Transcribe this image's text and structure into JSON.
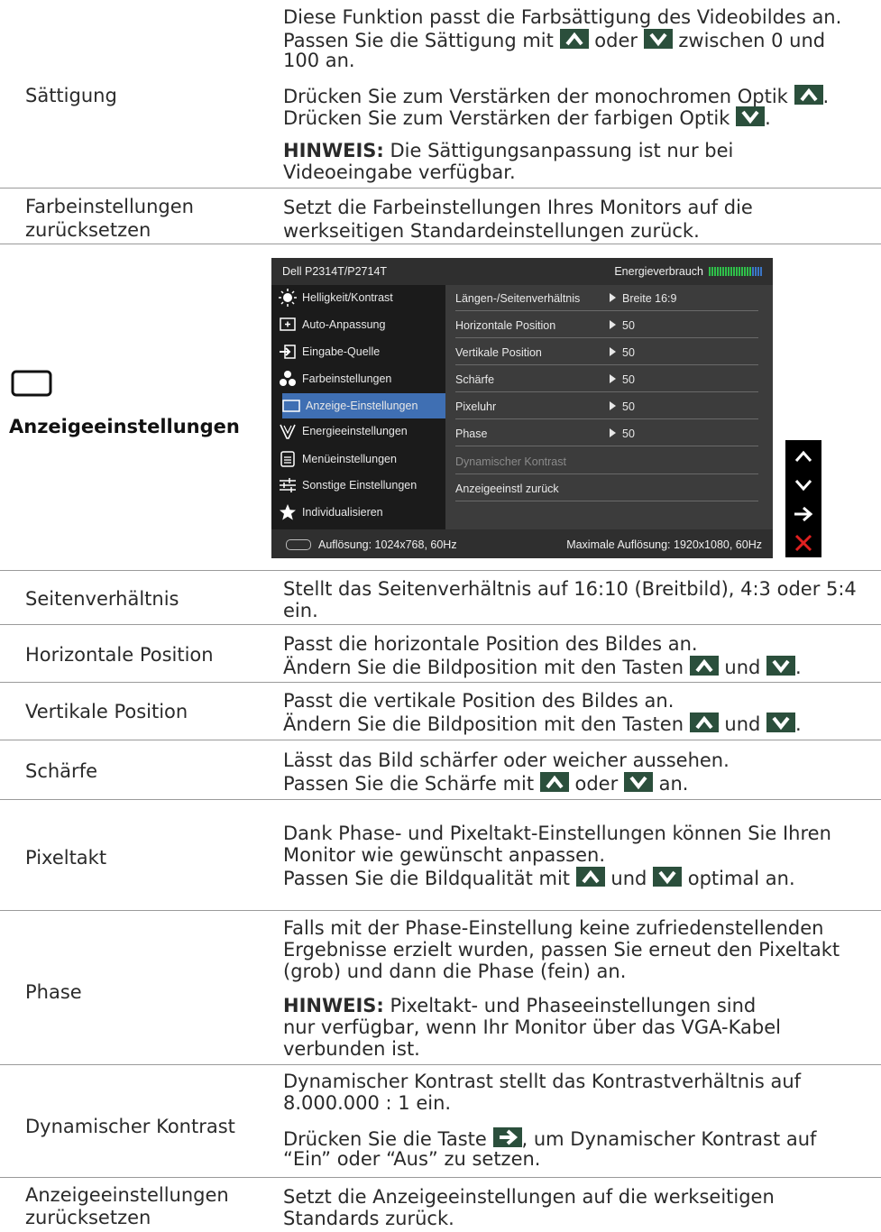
{
  "saettigung": {
    "label": "Sättigung",
    "l1": "Diese Funktion passt die Farbsättigung des Videobildes an.",
    "l2a": "Passen Sie die Sättigung mit",
    "l2b": "oder",
    "l2c": "zwischen 0 und",
    "l3": "100 an.",
    "l4": "Drücken Sie zum Verstärken der monochromen Optik",
    "l4end": ".",
    "l5": "Drücken Sie zum Verstärken der farbigen Optik",
    "l5end": ".",
    "note_label": "HINWEIS:",
    "note1": " Die Sättigungsanpassung ist nur bei",
    "note2": "Videoeingabe verfügbar."
  },
  "farbreset": {
    "label1": "Farbeinstellungen",
    "label2": "zurücksetzen",
    "l1": "Setzt die Farbeinstellungen Ihres Monitors auf die",
    "l2": "werkseitigen Standardeinstellungen zurück."
  },
  "section": {
    "title": "Anzeigeeinstellungen",
    "icon": "display-icon"
  },
  "osd": {
    "title": "Dell P2314T/P2714T",
    "energy_label": "Energieverbrauch",
    "energy_level": 0.8,
    "menu": [
      {
        "label": "Helligkeit/Kontrast",
        "icon": "brightness-icon"
      },
      {
        "label": "Auto-Anpassung",
        "icon": "auto-adjust-icon"
      },
      {
        "label": "Eingabe-Quelle",
        "icon": "input-source-icon"
      },
      {
        "label": "Farbeinstellungen",
        "icon": "color-icon"
      },
      {
        "label": "Anzeige-Einstellungen",
        "icon": "display-icon"
      },
      {
        "label": "Energieeinstellungen",
        "icon": "energy-icon"
      },
      {
        "label": "Menüeinstellungen",
        "icon": "menu-icon"
      },
      {
        "label": "Sonstige Einstellungen",
        "icon": "other-settings-icon"
      },
      {
        "label": "Individualisieren",
        "icon": "star-icon"
      }
    ],
    "selected_menu": "Anzeige-Einstellungen",
    "options": [
      {
        "key": "Längen-/Seitenverhältnis",
        "value": "Breite 16:9"
      },
      {
        "key": "Horizontale Position",
        "value": "50"
      },
      {
        "key": "Vertikale Position",
        "value": "50"
      },
      {
        "key": "Schärfe",
        "value": "50"
      },
      {
        "key": "Pixeluhr",
        "value": "50"
      },
      {
        "key": "Phase",
        "value": "50"
      },
      {
        "key": "Dynamischer Kontrast",
        "value": ""
      },
      {
        "key": "Anzeigeeinstl zurück",
        "value": ""
      }
    ],
    "resolution": "Auflösung: 1024x768, 60Hz",
    "max_resolution": "Maximale Auflösung: 1920x1080, 60Hz",
    "side_keys": [
      "up-arrow-icon",
      "down-arrow-icon",
      "right-arrow-icon",
      "close-icon"
    ]
  },
  "seitenverhaeltnis": {
    "label": "Seitenverhältnis",
    "l1": "Stellt das Seitenverhältnis auf 16:10 (Breitbild), 4:3 oder 5:4",
    "l2": "ein."
  },
  "horizontal": {
    "label": "Horizontale Position",
    "l1": "Passt die horizontale Position des Bildes an.",
    "l2a": "Ändern Sie die Bildposition mit den Tasten",
    "l2b": "und",
    "l2end": "."
  },
  "vertikal": {
    "label": "Vertikale Position",
    "l1": "Passt die vertikale Position des Bildes an.",
    "l2a": "Ändern Sie die Bildposition mit den Tasten",
    "l2b": "und",
    "l2end": "."
  },
  "schaerfe": {
    "label": "Schärfe",
    "l1": "Lässt das Bild schärfer oder weicher aussehen.",
    "l2a": "Passen Sie die Schärfe mit",
    "l2b": "oder",
    "l2c": "an."
  },
  "pixeltakt": {
    "label": "Pixeltakt",
    "l1": "Dank Phase- und Pixeltakt-Einstellungen können Sie Ihren",
    "l2": "Monitor wie gewünscht anpassen.",
    "l3a": "Passen Sie die Bildqualität mit",
    "l3b": "und",
    "l3c": "optimal an."
  },
  "phase": {
    "label": "Phase",
    "l1": "Falls mit der Phase-Einstellung keine zufriedenstellenden",
    "l2": "Ergebnisse erzielt wurden, passen Sie erneut den Pixeltakt",
    "l3": "(grob) und dann die Phase (fein) an.",
    "note_label": "HINWEIS:",
    "note1": " Pixeltakt- und Phaseeinstellungen sind",
    "note2": "nur verfügbar, wenn Ihr Monitor über das VGA-Kabel",
    "note3": "verbunden ist."
  },
  "dynkontrast": {
    "label": "Dynamischer Kontrast",
    "l1": "Dynamischer  Kontrast stellt das Kontrastverhältnis auf",
    "l2": "8.000.000 : 1 ein.",
    "l3a": "Drücken Sie die Taste",
    "l3b": ", um Dynamischer Kontrast auf",
    "l4": "“Ein” oder “Aus” zu setzen."
  },
  "anzeigereset": {
    "label1": "Anzeigeeinstellungen",
    "label2": "zurücksetzen",
    "l1": "Setzt die Anzeigeeinstellungen auf die werkseitigen",
    "l2": "Standards zurück."
  },
  "colors": {
    "button_bg": "#2b4f3c",
    "osd_selected": "#3f6fb3",
    "energy_green": "#2fc04a"
  }
}
